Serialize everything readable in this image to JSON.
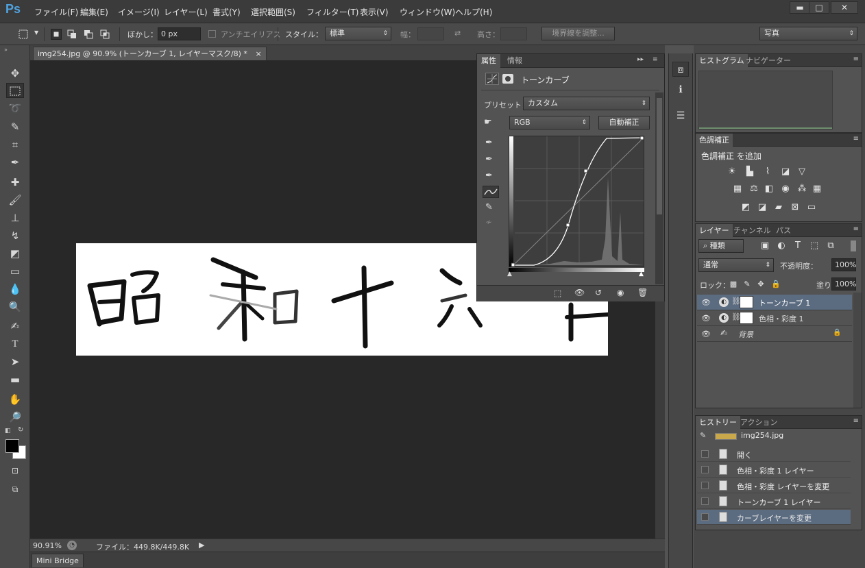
{
  "app": {
    "logo": "Ps"
  },
  "menu": [
    "ファイル(F)",
    "編集(E)",
    "イメージ(I)",
    "レイヤー(L)",
    "書式(Y)",
    "選択範囲(S)",
    "フィルター(T)",
    "表示(V)",
    "ウィンドウ(W)",
    "ヘルプ(H)"
  ],
  "window_controls": {
    "minimize": "▬",
    "maximize": "□",
    "close": "✕"
  },
  "options": {
    "feather_label": "ぼかし：",
    "feather_value": "0 px",
    "antialias_label": "アンチエイリアス",
    "style_label": "スタイル：",
    "style_value": "標準",
    "width_label": "幅：",
    "height_label": "高さ：",
    "refine_edge": "境界線を調整...",
    "workspace": "写真"
  },
  "document": {
    "tab_title": "img254.jpg @ 90.9% (トーンカーブ 1, レイヤーマスク/8) *",
    "close_icon": "×",
    "image_text": "昭和十六年",
    "zoom": "90.91%",
    "file_info": "ファイル：449.8K/449.8K"
  },
  "mini_bridge": "Mini Bridge",
  "properties": {
    "tabs": [
      "属性",
      "情報"
    ],
    "type": "トーンカーブ",
    "preset_label": "プリセット：",
    "preset_value": "カスタム",
    "channel": "RGB",
    "auto_button": "自動補正"
  },
  "histogram": {
    "tabs": [
      "ヒストグラム",
      "ナビゲーター"
    ]
  },
  "adjustments": {
    "tab": "色調補正",
    "add_label": "色調補正 を追加"
  },
  "layers_panel": {
    "tabs": [
      "レイヤー",
      "チャンネル",
      "パス"
    ],
    "filter": "種類",
    "blend_mode": "通常",
    "opacity_label": "不透明度：",
    "opacity_value": "100%",
    "lock_label": "ロック：",
    "fill_label": "塗り：",
    "fill_value": "100%",
    "layers": [
      {
        "name": "トーンカーブ 1",
        "selected": true
      },
      {
        "name": "色相・彩度 1",
        "selected": false
      },
      {
        "name": "背景",
        "selected": false
      }
    ]
  },
  "history_panel": {
    "tabs": [
      "ヒストリー",
      "アクション"
    ],
    "snapshot": "img254.jpg",
    "items": [
      {
        "label": "開く",
        "selected": false
      },
      {
        "label": "色相・彩度 1 レイヤー",
        "selected": false
      },
      {
        "label": "色相・彩度 レイヤーを変更",
        "selected": false
      },
      {
        "label": "トーンカーブ 1 レイヤー",
        "selected": false
      },
      {
        "label": "カーブレイヤーを変更",
        "selected": true
      }
    ]
  },
  "colors": {
    "accent": "#4fa3e0",
    "selection": "#5b6b80",
    "canvas": "#282828",
    "panel": "#535353"
  }
}
